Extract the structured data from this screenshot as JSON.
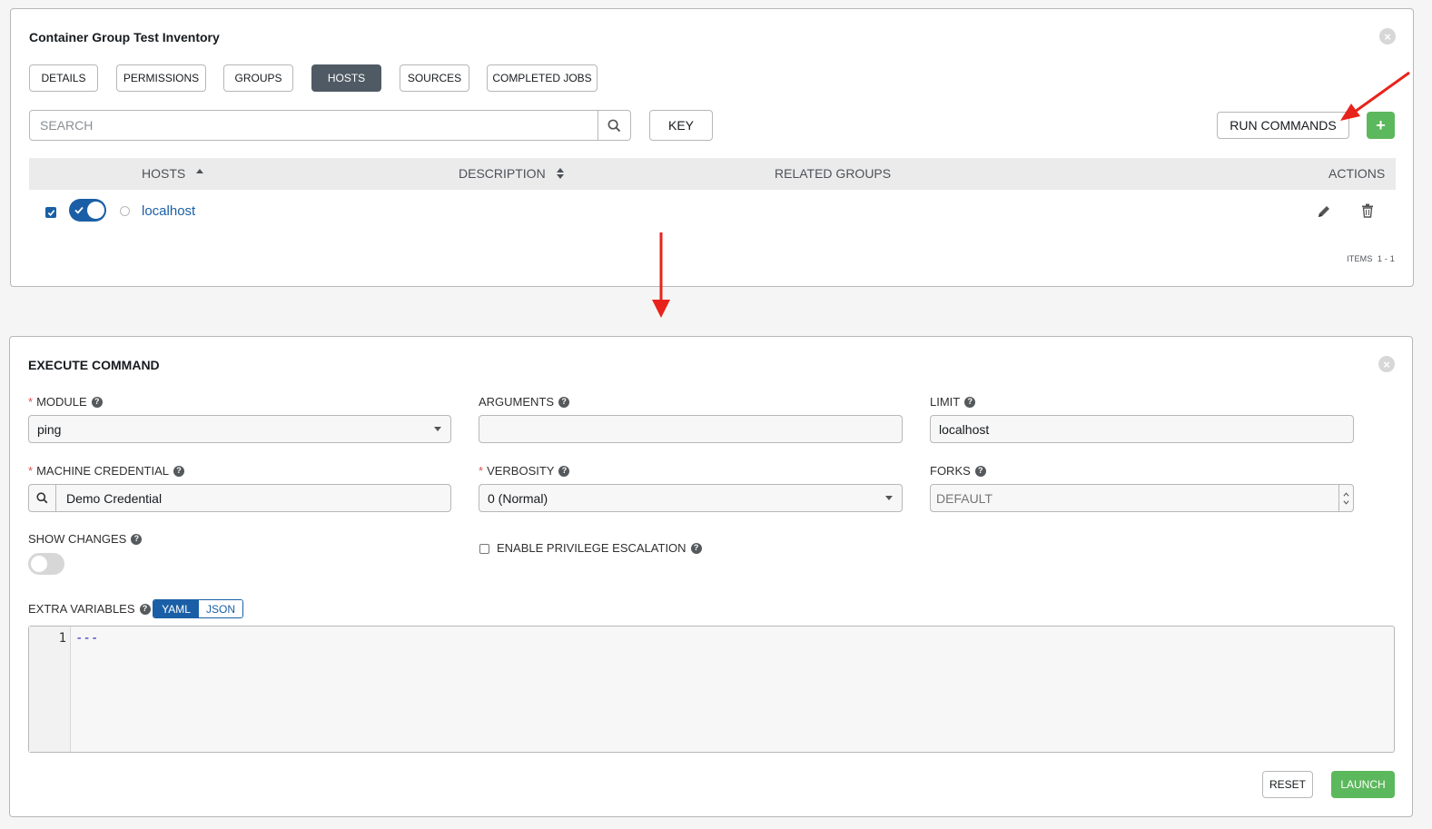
{
  "inventory": {
    "title": "Container Group Test Inventory",
    "tabs": [
      {
        "label": "DETAILS",
        "active": false
      },
      {
        "label": "PERMISSIONS",
        "active": false
      },
      {
        "label": "GROUPS",
        "active": false
      },
      {
        "label": "HOSTS",
        "active": true
      },
      {
        "label": "SOURCES",
        "active": false
      },
      {
        "label": "COMPLETED JOBS",
        "active": false
      }
    ],
    "search": {
      "placeholder": "SEARCH",
      "icon": "search-icon"
    },
    "key_button": "KEY",
    "run_commands_button": "RUN COMMANDS",
    "add_button": "+",
    "table": {
      "columns": [
        "HOSTS",
        "DESCRIPTION",
        "RELATED GROUPS",
        "ACTIONS"
      ],
      "rows": [
        {
          "checked": true,
          "enabled": true,
          "name": "localhost",
          "description": "",
          "related_groups": ""
        }
      ]
    },
    "items_label": "ITEMS",
    "items_range": "1 - 1"
  },
  "execute": {
    "title": "EXECUTE COMMAND",
    "module": {
      "label": "MODULE",
      "required": true,
      "value": "ping"
    },
    "arguments": {
      "label": "ARGUMENTS",
      "value": ""
    },
    "limit": {
      "label": "LIMIT",
      "value": "localhost"
    },
    "machine_credential": {
      "label": "MACHINE CREDENTIAL",
      "required": true,
      "value": "Demo Credential"
    },
    "verbosity": {
      "label": "VERBOSITY",
      "required": true,
      "value": "0 (Normal)"
    },
    "forks": {
      "label": "FORKS",
      "placeholder": "DEFAULT"
    },
    "show_changes": {
      "label": "SHOW CHANGES",
      "enabled": false
    },
    "privilege_escalation": {
      "label": "ENABLE PRIVILEGE ESCALATION",
      "checked": false
    },
    "extra_variables": {
      "label": "EXTRA VARIABLES",
      "modes": [
        "YAML",
        "JSON"
      ],
      "active_mode": "YAML",
      "line_number": "1",
      "content": "---"
    },
    "reset_button": "RESET",
    "launch_button": "LAUNCH"
  },
  "colors": {
    "accent_blue": "#1a5fa6",
    "active_tab": "#4f5a64",
    "success_green": "#5cb85c",
    "annotation_red": "#e8231b"
  }
}
